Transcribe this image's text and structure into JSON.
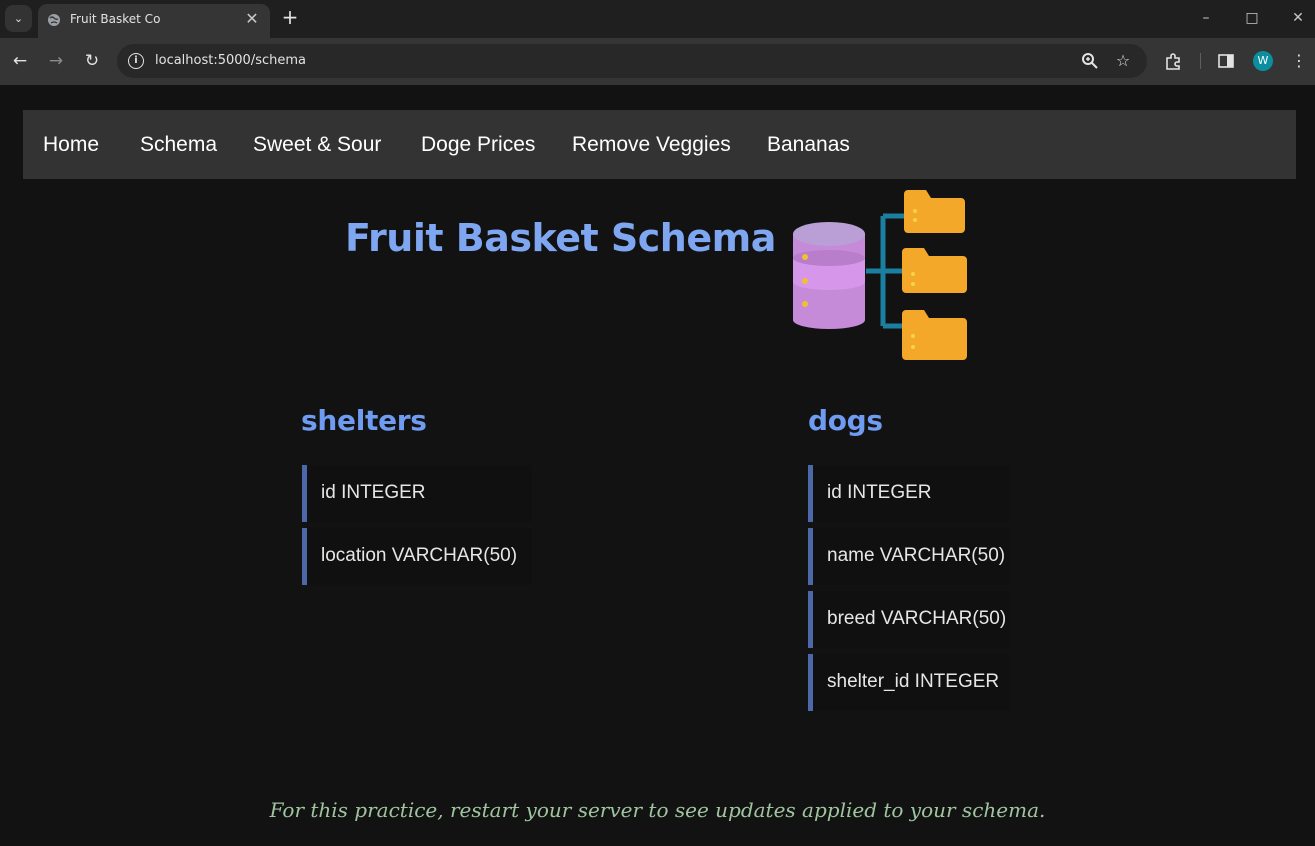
{
  "browser": {
    "tab_title": "Fruit Basket Co",
    "url": "localhost:5000/schema",
    "profile_initial": "W"
  },
  "nav": {
    "links": [
      "Home",
      "Schema",
      "Sweet & Sour",
      "Doge Prices",
      "Remove Veggies",
      "Bananas"
    ]
  },
  "page": {
    "title": "Fruit Basket Schema"
  },
  "tables": [
    {
      "name": "shelters",
      "columns": [
        "id INTEGER",
        "location VARCHAR(50)"
      ]
    },
    {
      "name": "dogs",
      "columns": [
        "id INTEGER",
        "name VARCHAR(50)",
        "breed VARCHAR(50)",
        "shelter_id INTEGER"
      ]
    }
  ],
  "footer": {
    "note": "For this practice, restart your server to see updates applied to your schema."
  },
  "colors": {
    "title": "#7fa6f0",
    "table_heading": "#6f9bf0",
    "column_border": "#4c68a8",
    "footer_note": "#9fc49f",
    "navbar_bg": "#333333"
  }
}
